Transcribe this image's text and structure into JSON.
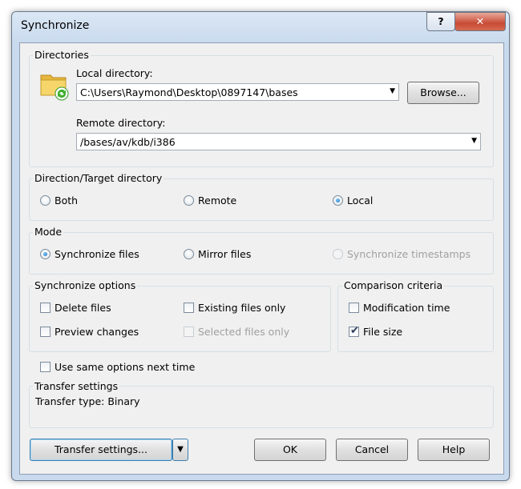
{
  "window": {
    "title": "Synchronize",
    "help_glyph": "?",
    "close_glyph": "✕"
  },
  "directories": {
    "group_label": "Directories",
    "local_label": "Local directory:",
    "local_value": "C:\\Users\\Raymond\\Desktop\\0897147\\bases",
    "browse_label": "Browse...",
    "remote_label": "Remote directory:",
    "remote_value": "/bases/av/kdb/i386"
  },
  "direction": {
    "group_label": "Direction/Target directory",
    "options": [
      "Both",
      "Remote",
      "Local"
    ],
    "selected": "Local"
  },
  "mode": {
    "group_label": "Mode",
    "options": [
      "Synchronize files",
      "Mirror files",
      "Synchronize timestamps"
    ],
    "selected": "Synchronize files"
  },
  "sync_options": {
    "group_label": "Synchronize options",
    "delete_files": "Delete files",
    "existing_files_only": "Existing files only",
    "preview_changes": "Preview changes",
    "selected_files_only": "Selected files only"
  },
  "comparison": {
    "group_label": "Comparison criteria",
    "modification_time": "Modification time",
    "file_size": "File size"
  },
  "use_same_options": "Use same options next time",
  "transfer": {
    "group_label": "Transfer settings",
    "type_text": "Transfer type: Binary"
  },
  "buttons": {
    "transfer_settings": "Transfer settings...",
    "ok": "OK",
    "cancel": "Cancel",
    "help": "Help"
  }
}
